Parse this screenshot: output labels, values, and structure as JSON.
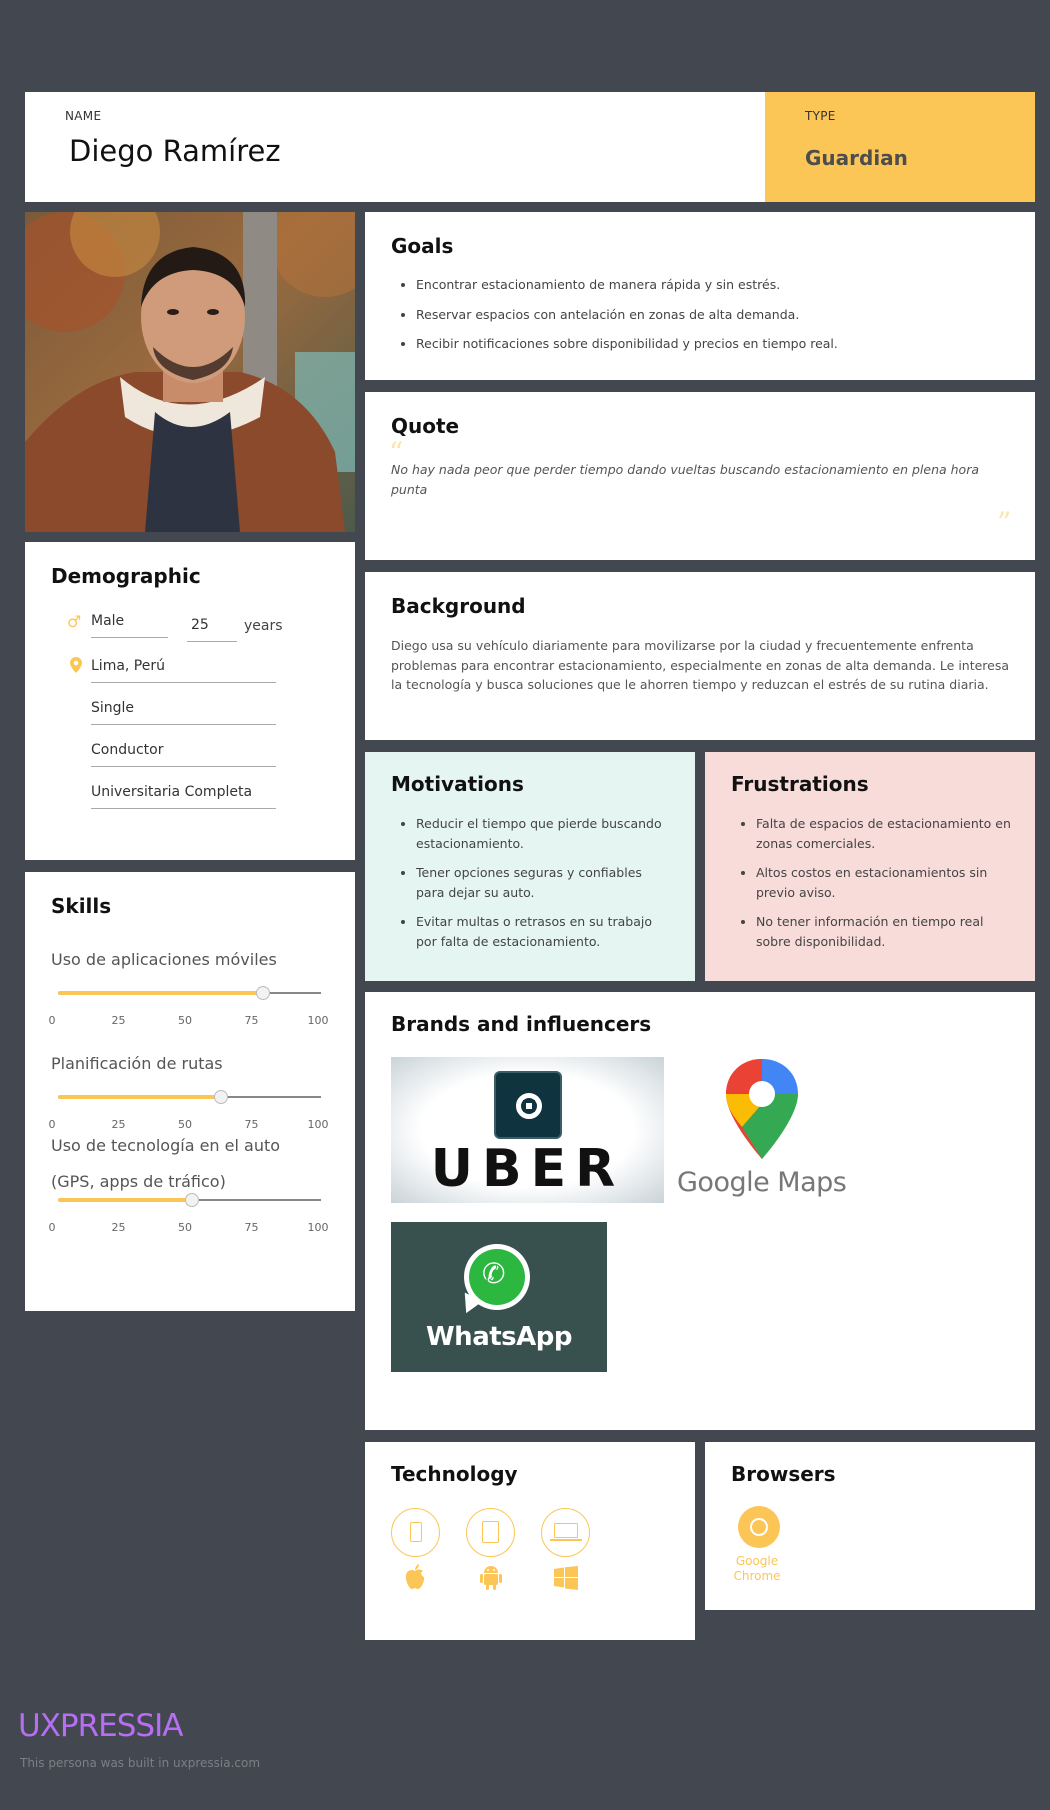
{
  "header": {
    "name_label": "NAME",
    "name": "Diego Ramírez",
    "type_label": "TYPE",
    "type": "Guardian"
  },
  "goals": {
    "title": "Goals",
    "items": [
      "Encontrar estacionamiento de manera rápida y sin estrés.",
      "Reservar espacios con antelación en zonas de alta demanda.",
      "Recibir notificaciones sobre disponibilidad y precios en tiempo real."
    ]
  },
  "quote": {
    "title": "Quote",
    "text": "No hay nada peor que perder tiempo dando vueltas buscando estacionamiento en plena hora punta"
  },
  "background": {
    "title": "Background",
    "text": "Diego usa su vehículo diariamente para movilizarse por la ciudad y frecuentemente enfrenta problemas para encontrar estacionamiento, especialmente en zonas de alta demanda. Le interesa la tecnología y busca soluciones que le ahorren tiempo y reduzcan el estrés de su rutina diaria."
  },
  "demographic": {
    "title": "Demographic",
    "gender": "Male",
    "age": "25",
    "age_unit": "years",
    "location": "Lima, Perú",
    "status": "Single",
    "occupation": "Conductor",
    "education": "Universitaria Completa"
  },
  "motivations": {
    "title": "Motivations",
    "items": [
      "Reducir el tiempo que pierde buscando estacionamiento.",
      "Tener opciones seguras y confiables para dejar su auto.",
      "Evitar multas o retrasos en su trabajo por falta de estacionamiento."
    ]
  },
  "frustrations": {
    "title": "Frustrations",
    "items": [
      "Falta de espacios de estacionamiento en zonas comerciales.",
      "Altos costos en estacionamientos sin previo aviso.",
      "No tener información en tiempo real sobre disponibilidad."
    ]
  },
  "skills": {
    "title": "Skills",
    "ticks": [
      "0",
      "25",
      "50",
      "75",
      "100"
    ],
    "items": [
      {
        "label": "Uso de aplicaciones móviles",
        "label2": "",
        "value": 78
      },
      {
        "label": "Planificación de rutas",
        "label2": "",
        "value": 62
      },
      {
        "label": "Uso de tecnología en el auto",
        "label2": "(GPS, apps de tráfico)",
        "value": 51
      }
    ]
  },
  "brands": {
    "title": "Brands and influencers",
    "uber": "UBER",
    "google_maps": "Google Maps",
    "whatsapp": "WhatsApp"
  },
  "technology": {
    "title": "Technology",
    "devices": [
      "phone-icon",
      "tablet-icon",
      "laptop-icon"
    ],
    "platforms": [
      "apple-icon",
      "android-icon",
      "windows-icon"
    ]
  },
  "browsers": {
    "title": "Browsers",
    "items": [
      "Google Chrome"
    ]
  },
  "footer": {
    "brand": "UXPRESSIA",
    "note": "This persona was built in uxpressia.com"
  },
  "colors": {
    "accent": "#fcc657",
    "background": "#43474f",
    "motivations_bg": "#e5f6f2",
    "frustrations_bg": "#f8dcda",
    "footer_brand": "#b66ef3"
  }
}
